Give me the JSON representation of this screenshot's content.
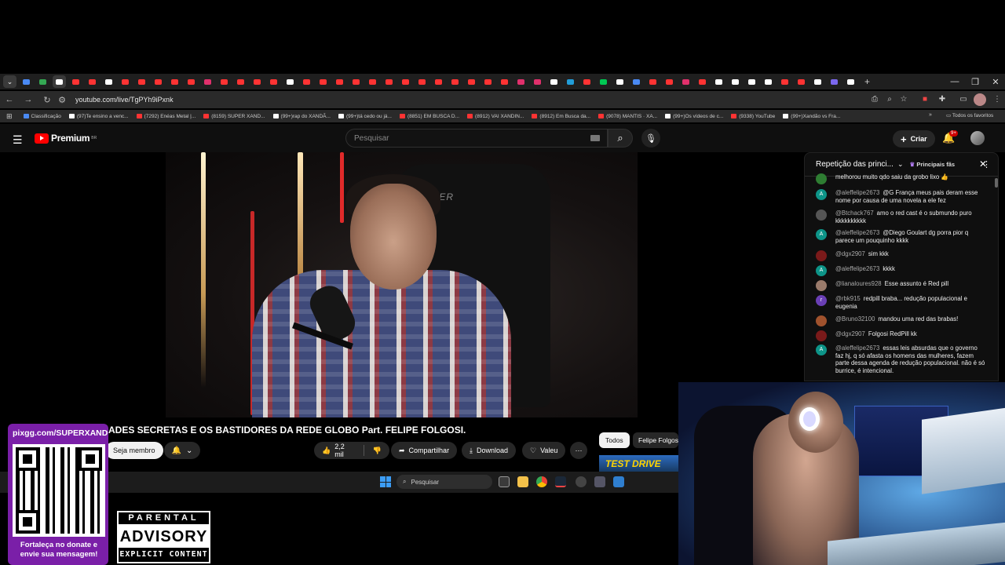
{
  "browser": {
    "url": "youtube.com/live/TgPYh9iPxnk",
    "tab_colors": [
      "#4a8af4",
      "#34a853",
      "#ffffff",
      "#ff3333",
      "#ff3333",
      "#ffffff",
      "#ff3333",
      "#ff3333",
      "#ff3333",
      "#ff3333",
      "#ff3333",
      "#e1306c",
      "#ff3333",
      "#ff3333",
      "#ff3333",
      "#ff3333",
      "#ffffff",
      "#ff3333",
      "#ff3333",
      "#ff3333",
      "#ff3333",
      "#ff3333",
      "#ff3333",
      "#ff3333",
      "#ff3333",
      "#ff3333",
      "#ff3333",
      "#ff3333",
      "#ff3333",
      "#ff3333",
      "#e1306c",
      "#e1306c",
      "#ffffff",
      "#229ed9",
      "#ff3333",
      "#00c853",
      "#ffffff",
      "#4a8af4",
      "#ff3333",
      "#ff3333",
      "#e1306c",
      "#ff3333",
      "#ffffff",
      "#ffffff",
      "#ffffff",
      "#ffffff",
      "#ff3333",
      "#ff3333",
      "#ffffff",
      "#7b68ee",
      "#ffffff"
    ],
    "bookmarks": [
      {
        "label": "Classificação",
        "color": "#4a8af4"
      },
      {
        "label": "(97)Te ensino a venc...",
        "color": "#ffffff"
      },
      {
        "label": "(7292) Enéas Metal |...",
        "color": "#ff3333"
      },
      {
        "label": "(8159) SUPER XAND...",
        "color": "#ff3333"
      },
      {
        "label": "(99+)rap do XANDÃ...",
        "color": "#ffffff"
      },
      {
        "label": "(99+)tá cedo ou já...",
        "color": "#ffffff"
      },
      {
        "label": "(8851) EM BUSCA D...",
        "color": "#ff3333"
      },
      {
        "label": "(8912) VAI XANDIN...",
        "color": "#ff3333"
      },
      {
        "label": "(8912) Em Busca da...",
        "color": "#ff3333"
      },
      {
        "label": "(9078) MANTIS · XA...",
        "color": "#ff3333"
      },
      {
        "label": "(99+)Os vídeos de c...",
        "color": "#ffffff"
      },
      {
        "label": "(9338) YouTube",
        "color": "#ff3333"
      },
      {
        "label": "(99+)Xandão vs Fra...",
        "color": "#ffffff"
      }
    ],
    "all_favorites": "Todos os favoritos"
  },
  "youtube": {
    "logo_text": "Premium",
    "logo_sup": "BR",
    "search_placeholder": "Pesquisar",
    "create_label": "Criar",
    "notif_count": "9+",
    "video_title": "ADES SECRETAS E OS BASTIDORES DA REDE GLOBO Part. FELIPE FOLGOSI.",
    "member_label": "Seja membro",
    "likes": "2,2 mil",
    "share_label": "Compartilhar",
    "download_label": "Download",
    "thanks_label": "Valeu",
    "chips": [
      "Todos",
      "Felipe Folgosi"
    ],
    "ad_text": "TEST DRIVE"
  },
  "video": {
    "chair_brand": "RACER"
  },
  "chat": {
    "title": "Repetição das princi...",
    "top_fans": "Principais fãs",
    "messages": [
      {
        "author": "",
        "text": "melhorou muito qdo saiu da grobo lixo 👍",
        "avatar": "",
        "color": "#2e7d32"
      },
      {
        "author": "@aleffelipe2673",
        "text": "@G França meus pais deram esse nome por causa de uma novela a ele fez",
        "avatar": "A",
        "color": "#0d9488"
      },
      {
        "author": "@Btchack767",
        "text": "amo o red cast é o submundo puro kkkkkkkkkk",
        "avatar": "",
        "color": "#555555"
      },
      {
        "author": "@aleffelipe2673",
        "text": "@Diego Goulart dg porra pior q parece um pouquinho kkkk",
        "avatar": "A",
        "color": "#0d9488"
      },
      {
        "author": "@dgx2907",
        "text": "sim kkk",
        "avatar": "",
        "color": "#7a1a1a"
      },
      {
        "author": "@aleffelipe2673",
        "text": "kkkk",
        "avatar": "A",
        "color": "#0d9488"
      },
      {
        "author": "@lianaloures928",
        "text": "Esse assunto é Red pill",
        "avatar": "",
        "color": "#9a7b6b"
      },
      {
        "author": "@rbk915",
        "text": "redpill braba... redução populacional e eugenia",
        "avatar": "r",
        "color": "#6a3fb5"
      },
      {
        "author": "@Bruno32100",
        "text": "mandou uma red das brabas!",
        "avatar": "",
        "color": "#a0522d"
      },
      {
        "author": "@dgx2907",
        "text": "Folgosi RedPill kk",
        "avatar": "",
        "color": "#7a1a1a"
      },
      {
        "author": "@aleffelipe2673",
        "text": "essas leis absurdas que o governo faz hj, q só afasta os homens das mulheres, fazem parte dessa agenda de redução populacional. não é só burrice, é intencional.",
        "avatar": "A",
        "color": "#0d9488"
      }
    ]
  },
  "taskbar": {
    "search_label": "Pesquisar"
  },
  "overlay": {
    "pix_url": "pixgg.com/SUPERXAND",
    "donate_text": "Fortaleça no donate e envie sua mensagem!",
    "advisory_top": "PARENTAL",
    "advisory_mid": "ADVISORY",
    "advisory_bot": "EXPLICIT CONTENT"
  }
}
